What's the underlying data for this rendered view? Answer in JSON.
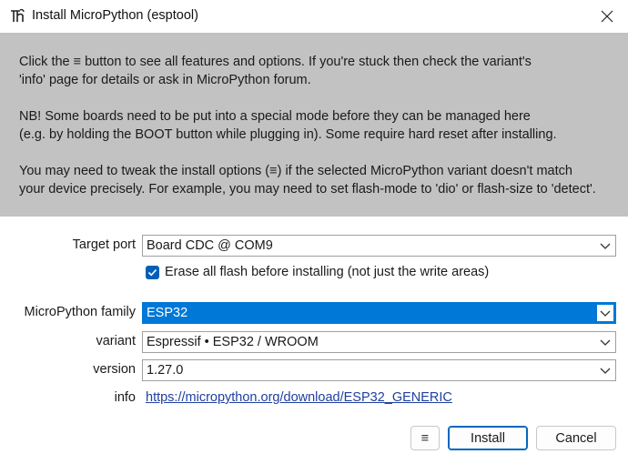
{
  "window": {
    "title": "Install MicroPython (esptool)"
  },
  "info": {
    "p1_line1": "Click the ≡ button to see all features and options. If you're stuck then check the variant's",
    "p1_line2": "'info' page for details or ask in MicroPython forum.",
    "p2_line1": "NB! Some boards need to be put into a special mode before they can be managed here",
    "p2_line2": "(e.g. by holding the BOOT button while plugging in). Some require hard reset after installing.",
    "p3_line1": "You may need to tweak the install options (≡) if the selected MicroPython variant doesn't match",
    "p3_line2": "your device precisely. For example, you may need to set flash-mode to 'dio' or flash-size to 'detect'."
  },
  "form": {
    "target_port_label": "Target port",
    "target_port_value": "Board CDC @ COM9",
    "erase_label": "Erase all flash before installing (not just the write areas)",
    "erase_checked": true,
    "family_label": "MicroPython family",
    "family_value": "ESP32",
    "variant_label": "variant",
    "variant_value": "Espressif • ESP32 / WROOM",
    "version_label": "version",
    "version_value": "1.27.0",
    "info_label": "info",
    "info_link": "https://micropython.org/download/ESP32_GENERIC"
  },
  "buttons": {
    "menu_label": "≡",
    "install_label": "Install",
    "cancel_label": "Cancel"
  },
  "colors": {
    "accent": "#0078d7",
    "info_bg": "#c2c2c2",
    "link": "#1f3fa0",
    "checkbox": "#005fb8"
  },
  "icons": {
    "app": "thonny-app-icon",
    "close": "close-icon",
    "dropdown": "chevron-down-icon",
    "check": "check-icon"
  }
}
